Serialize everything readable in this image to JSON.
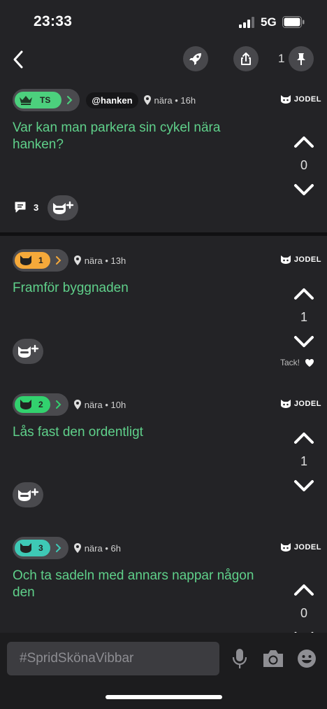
{
  "status_bar": {
    "time": "23:33",
    "network": "5G"
  },
  "nav": {
    "pin_count": "1"
  },
  "brand": "JODEL",
  "posts": [
    {
      "badge_label": "TS",
      "badge_color": "#4cd07d",
      "handle": "@hanken",
      "location": "nära",
      "age": "16h",
      "text": "Var kan man parkera sin cykel nära hanken?",
      "votes": "0",
      "comments": "3"
    },
    {
      "badge_label": "1",
      "badge_color": "#f5a93a",
      "location": "nära",
      "age": "13h",
      "text": "Framför byggnaden",
      "votes": "1",
      "thanks": "Tack!"
    },
    {
      "badge_label": "2",
      "badge_color": "#32d16e",
      "location": "nära",
      "age": "10h",
      "text": "Lås fast den ordentligt",
      "votes": "1"
    },
    {
      "badge_label": "3",
      "badge_color": "#3ec9b6",
      "location": "nära",
      "age": "6h",
      "text": "Och ta sadeln med annars nappar någon den",
      "votes": "0"
    }
  ],
  "composer": {
    "placeholder": "#SpridSkönaVibbar"
  },
  "icons": [
    "back-icon",
    "rocket-icon",
    "share-icon",
    "pin-icon",
    "crown-icon",
    "location-pin-icon",
    "jodel-logo-icon",
    "upvote-icon",
    "downvote-icon",
    "comment-icon",
    "cat-add-icon",
    "heart-icon",
    "mic-icon",
    "camera-icon",
    "sticker-icon"
  ]
}
